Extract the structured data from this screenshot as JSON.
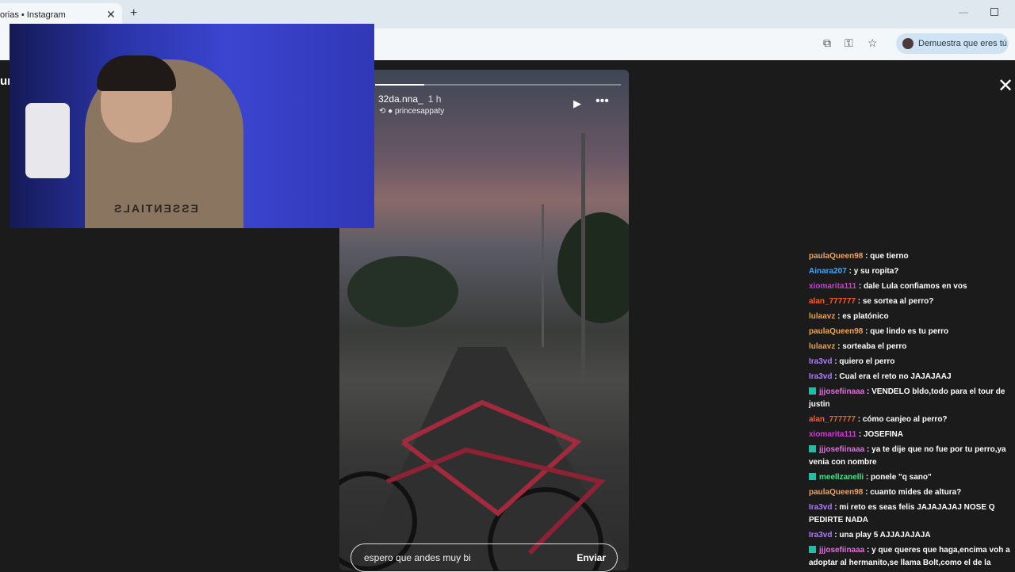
{
  "browser": {
    "tab_title": "orias • Instagram",
    "tab_close": "✕",
    "new_tab": "+",
    "minimize": "—",
    "verify_label": "Demuestra que eres tú"
  },
  "story": {
    "username": "32da.nna_",
    "time": "1 h",
    "repost_user": "princesappaty",
    "progress": 0.2,
    "play_icon": "play-icon",
    "more_icon": "more-icon",
    "reply_value": "espero que andes muy bi",
    "send_label": "Enviar"
  },
  "page": {
    "left_clipped_text": "ur",
    "close_symbol": "✕"
  },
  "webcam": {
    "shirt_text": "ESSENTIALS"
  },
  "chat": [
    {
      "user": "paulaQueen98",
      "color": "#f0a35a",
      "badge": false,
      "text": "que tierno"
    },
    {
      "user": "Ainara207",
      "color": "#3fa8ff",
      "badge": false,
      "text": "y su ropita?"
    },
    {
      "user": "xiomarita111",
      "color": "#d23ad6",
      "badge": false,
      "text": "dale Lula confiamos en vos"
    },
    {
      "user": "alan_777777",
      "color": "#ff5a2a",
      "badge": false,
      "text": "se sortea al perro?"
    },
    {
      "user": "lulaavz",
      "color": "#e6a23c",
      "badge": false,
      "text": "es platónico"
    },
    {
      "user": "paulaQueen98",
      "color": "#f0a35a",
      "badge": false,
      "text": "que lindo es tu perro"
    },
    {
      "user": "lulaavz",
      "color": "#e6a23c",
      "badge": false,
      "text": "sorteaba el perro"
    },
    {
      "user": "Ira3vd",
      "color": "#b07bff",
      "badge": false,
      "text": "quiero el perro"
    },
    {
      "user": "Ira3vd",
      "color": "#b07bff",
      "badge": false,
      "text": "Cual era el reto no JAJAJAAJ"
    },
    {
      "user": "jjjosefiinaaa",
      "color": "#e070e0",
      "badge": true,
      "text": "VENDELO bldo,todo para el tour de justin"
    },
    {
      "user": "alan_777777",
      "color": "#ff5a2a",
      "badge": false,
      "text": "cómo canjeo al perro?"
    },
    {
      "user": "xiomarita111",
      "color": "#d23ad6",
      "badge": false,
      "text": "JOSEFINA"
    },
    {
      "user": "jjjosefiinaaa",
      "color": "#e070e0",
      "badge": true,
      "text": "ya te dije que no fue por tu perro,ya venia con nombre"
    },
    {
      "user": "meellzanelli",
      "color": "#4fe08a",
      "badge": true,
      "text": "ponele \"q sano\""
    },
    {
      "user": "paulaQueen98",
      "color": "#f0a35a",
      "badge": false,
      "text": "cuanto mides de altura?"
    },
    {
      "user": "Ira3vd",
      "color": "#b07bff",
      "badge": false,
      "text": "mi reto es seas felis JAJAJAJAJ NOSE Q PEDIRTE NADA"
    },
    {
      "user": "Ira3vd",
      "color": "#b07bff",
      "badge": false,
      "text": "una play 5 AJJAJAJAJA"
    },
    {
      "user": "jjjosefiinaaa",
      "color": "#e070e0",
      "badge": true,
      "text": "y que queres que haga,encima voh a adoptar al hermanito,se llama Bolt,como el de la pelicula"
    }
  ]
}
